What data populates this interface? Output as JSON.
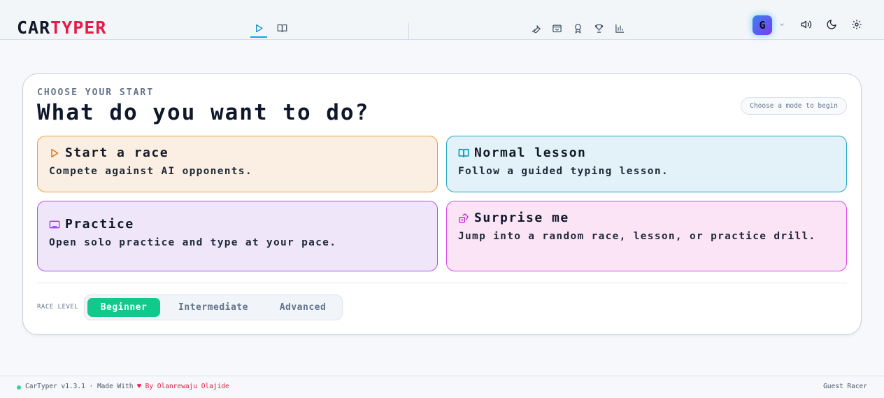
{
  "header": {
    "logo_part1": "CAR",
    "logo_part2": "TYPER",
    "nav": [
      {
        "name": "race",
        "icon": "play-icon",
        "active": true
      },
      {
        "name": "lesson",
        "icon": "book-icon",
        "active": false
      }
    ],
    "tools": [
      "wrench-icon",
      "bag-icon",
      "award-icon",
      "trophy-icon",
      "bar-chart-icon"
    ],
    "avatar_initial": "G",
    "controls": [
      "volume-icon",
      "moon-icon",
      "gear-icon"
    ]
  },
  "main": {
    "eyebrow": "CHOOSE YOUR START",
    "title": "What do you want to do?",
    "hint": "Choose a mode to begin",
    "modes": [
      {
        "title": "Start a race",
        "desc": "Compete against AI opponents.",
        "icon": "play-icon"
      },
      {
        "title": "Normal lesson",
        "desc": "Follow a guided typing lesson.",
        "icon": "book-icon"
      },
      {
        "title": "Practice",
        "desc": "Open solo practice and type at your pace.",
        "icon": "keyboard-icon"
      },
      {
        "title": "Surprise me",
        "desc": "Jump into a random race, lesson, or practice drill.",
        "icon": "dice-icon"
      }
    ],
    "race_level_label": "RACE LEVEL",
    "levels": [
      "Beginner",
      "Intermediate",
      "Advanced"
    ],
    "selected_level": "Beginner"
  },
  "footer": {
    "version": "CarTyper v1.3.1 · Made With",
    "heart": "♥",
    "author": "By Olanrewaju Olajide",
    "user": "Guest Racer"
  },
  "colors": {
    "brand_red": "#e11d48",
    "accent_blue": "#0ea5e9",
    "level_active": "#10c98a"
  }
}
